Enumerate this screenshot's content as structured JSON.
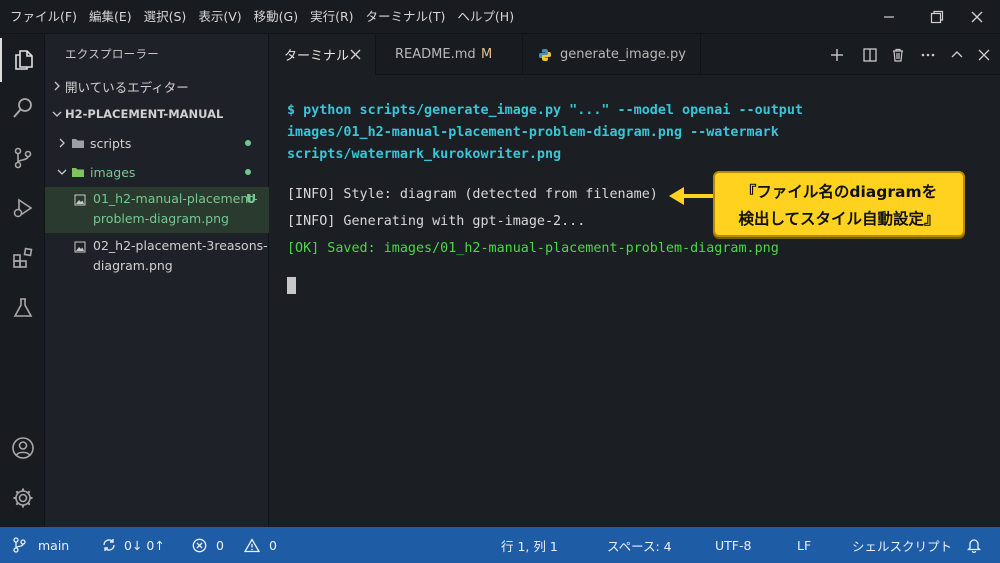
{
  "menu": [
    "ファイル(F)",
    "編集(E)",
    "選択(S)",
    "表示(V)",
    "移動(G)",
    "実行(R)",
    "ターミナル(T)",
    "ヘルプ(H)"
  ],
  "explorer": {
    "title": "エクスプローラー",
    "open_editors": "開いているエディター",
    "project": "H2-PLACEMENT-MANUAL",
    "folders": [
      {
        "name": "scripts"
      },
      {
        "name": "images"
      }
    ],
    "files": [
      {
        "line1": "01_h2-manual-placement-",
        "line2": "problem-diagram.png",
        "badge": "U"
      },
      {
        "line1": "02_h2-placement-3reasons-",
        "line2": "diagram.png"
      }
    ]
  },
  "tabs": [
    {
      "label": "ターミナル"
    },
    {
      "label": "README.md",
      "badge": "M"
    },
    {
      "label": "generate_image.py"
    }
  ],
  "terminal": {
    "command": [
      "$ python scripts/generate_image.py \"...\" --model openai --output",
      "images/01_h2-manual-placement-problem-diagram.png --watermark",
      "scripts/watermark_kurokowriter.png"
    ],
    "info1": "[INFO] Style: diagram (detected from filename)",
    "info2": "[INFO] Generating with gpt-image-2...",
    "ok": "[OK] Saved: images/01_h2-manual-placement-problem-diagram.png"
  },
  "callout": {
    "line1": "『ファイル名のdiagramを",
    "line2": "検出してスタイル自動設定』"
  },
  "status": {
    "branch": "main",
    "sync": "0↓ 0↑",
    "errors": "0",
    "warnings": "0",
    "position": "行 1, 列 1",
    "spaces": "スペース: 4",
    "encoding": "UTF-8",
    "eol": "LF",
    "language": "シェルスクリプト"
  },
  "colors": {
    "accent_status": "#1f5ca6",
    "git_untracked": "#73c991",
    "git_modified": "#e2c08d",
    "terminal_command": "#39c5d6",
    "terminal_ok": "#4fd44a",
    "callout_bg": "#ffd21f"
  },
  "icons": [
    "files-icon",
    "search-icon",
    "source-control-icon",
    "run-debug-icon",
    "extensions-icon",
    "testing-icon",
    "account-icon",
    "gear-icon",
    "python-icon",
    "image-file-icon",
    "folder-icon",
    "bell-icon"
  ]
}
